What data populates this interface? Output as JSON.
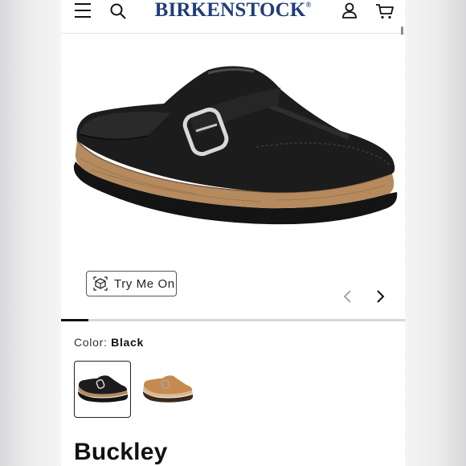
{
  "header": {
    "brand": "BIRKENSTOCK",
    "brand_mark": "®",
    "icons": [
      "menu-icon",
      "search-icon",
      "account-icon",
      "cart-icon"
    ]
  },
  "gallery": {
    "try_on_label": "Try Me On",
    "progress": 0.08
  },
  "product": {
    "color_label": "Color:",
    "color_value": "Black",
    "swatches": [
      {
        "color": "Black",
        "selected": true
      },
      {
        "color": "Tan",
        "selected": false
      }
    ],
    "name": "Buckley"
  },
  "colors": {
    "brand_blue": "#1f3d7a",
    "shoe_black": "#1c1c1c",
    "cork": "#b48a5e",
    "tan_leather": "#c58a4f"
  }
}
